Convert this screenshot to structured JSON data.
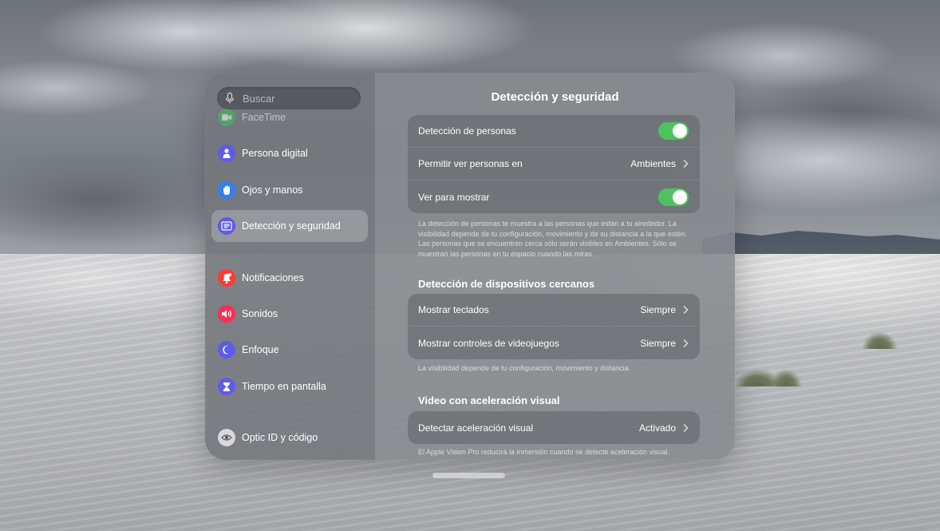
{
  "search": {
    "placeholder": "Buscar"
  },
  "sidebar": {
    "items": [
      {
        "label": "FaceTime",
        "icon": "facetime-icon",
        "color": "#34c759"
      },
      {
        "label": "Persona digital",
        "icon": "persona-icon",
        "color": "#5e5ce6"
      },
      {
        "label": "Ojos y manos",
        "icon": "hand-icon",
        "color": "#2f7ff5"
      },
      {
        "label": "Detección y seguridad",
        "icon": "detection-icon",
        "color": "#5e5ce6"
      },
      {
        "label": "Notificaciones",
        "icon": "bell-icon",
        "color": "#ff3b30"
      },
      {
        "label": "Sonidos",
        "icon": "speaker-icon",
        "color": "#ff2d55"
      },
      {
        "label": "Enfoque",
        "icon": "moon-icon",
        "color": "#5e5ce6"
      },
      {
        "label": "Tiempo en pantalla",
        "icon": "hourglass-icon",
        "color": "#5e5ce6"
      },
      {
        "label": "Optic ID y código",
        "icon": "optic-id-icon",
        "color": "#d8d8dc"
      }
    ]
  },
  "main": {
    "title": "Detección y seguridad",
    "group1": {
      "people_detection": "Detección de personas",
      "allow_see_people": "Permitir ver personas en",
      "allow_see_people_value": "Ambientes",
      "look_to_reveal": "Ver para mostrar"
    },
    "footer1": "La detección de personas te muestra a las personas que están a tu alrededor. La visibilidad depende de tu configuración, movimiento y de su distancia a la que estén. Las personas que se encuentren cerca sólo serán visibles en Ambientes. Sólo se muestran las personas en tu espacio cuando las miras.",
    "section2": "Detección de dispositivos cercanos",
    "group2": {
      "show_keyboards": "Mostrar teclados",
      "show_keyboards_value": "Siempre",
      "show_controllers": "Mostrar controles de videojuegos",
      "show_controllers_value": "Siempre"
    },
    "footer2": "La visibilidad depende de tu configuración, movimiento y distancia.",
    "section3": "Video con aceleración visual",
    "group3": {
      "detect_motion": "Detectar aceleración visual",
      "detect_motion_value": "Activado"
    },
    "footer3": "El Apple Vision Pro reducirá la inmersión cuando se detecte aceleración visual."
  },
  "colors": {
    "toggle_on": "#4cc35e"
  }
}
